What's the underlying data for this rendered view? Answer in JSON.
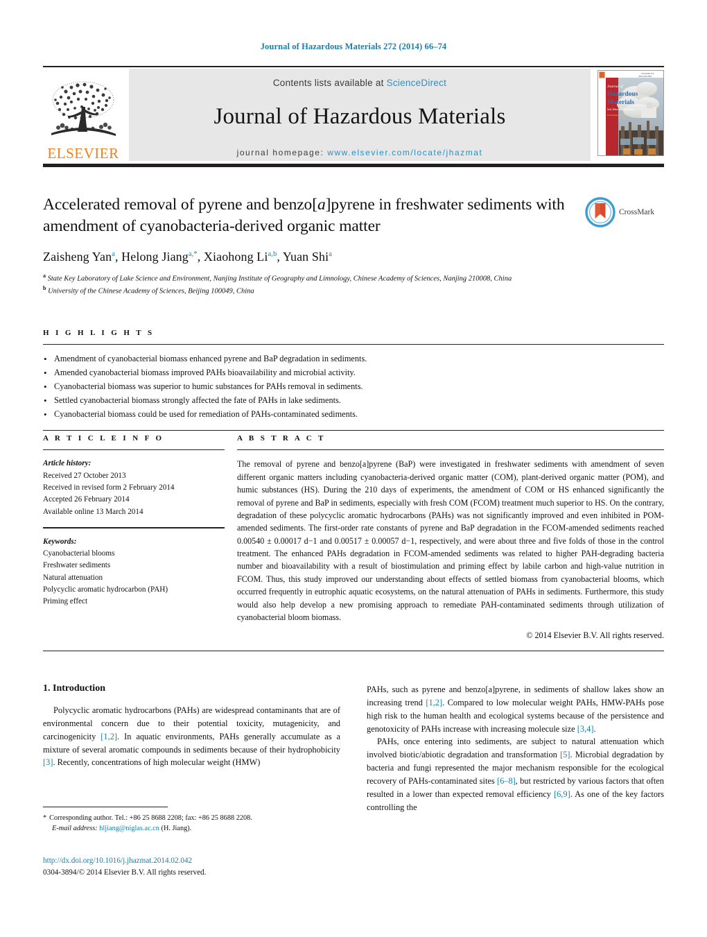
{
  "running_head": "Journal of Hazardous Materials 272 (2014) 66–74",
  "masthead": {
    "contents_prefix": "Contents lists available at ",
    "sciencedirect": "ScienceDirect",
    "journal_title": "Journal of Hazardous Materials",
    "homepage_prefix": "journal homepage: ",
    "homepage_url": "www.elsevier.com/locate/jhazmat",
    "publisher": "ELSEVIER",
    "publisher_logo_icon": "elsevier-tree-icon",
    "cover_icon": "journal-cover-thumbnail",
    "cover_title_line1": "Journal of",
    "cover_title_line2": "Hazardous",
    "cover_title_line3": "Materials"
  },
  "article": {
    "title": "Accelerated removal of pyrene and benzo[a]pyrene in freshwater sediments with amendment of cyanobacteria-derived organic matter",
    "title_part1": "Accelerated removal of pyrene and benzo[",
    "title_italic": "a",
    "title_part2": "]pyrene in freshwater sediments with amendment of cyanobacteria-derived organic matter",
    "crossmark_label": "CrossMark",
    "authors": [
      {
        "name": "Zaisheng Yan",
        "sup": "a"
      },
      {
        "name": "Helong Jiang",
        "sup": "a,*"
      },
      {
        "name": "Xiaohong Li",
        "sup": "a,b"
      },
      {
        "name": "Yuan Shi",
        "sup": "a"
      }
    ],
    "affiliations": [
      {
        "marker": "a",
        "text": "State Key Laboratory of Lake Science and Environment, Nanjing Institute of Geography and Limnology, Chinese Academy of Sciences, Nanjing 210008, China"
      },
      {
        "marker": "b",
        "text": "University of the Chinese Academy of Sciences, Beijing 100049, China"
      }
    ]
  },
  "highlights": {
    "label": "H I G H L I G H T S",
    "items": [
      "Amendment of cyanobacterial biomass enhanced pyrene and BaP degradation in sediments.",
      "Amended cyanobacterial biomass improved PAHs bioavailability and microbial activity.",
      "Cyanobacterial biomass was superior to humic substances for PAHs removal in sediments.",
      "Settled cyanobacterial biomass strongly affected the fate of PAHs in lake sediments.",
      "Cyanobacterial biomass could be used for remediation of PAHs-contaminated sediments."
    ]
  },
  "article_info": {
    "label": "A R T I C L E    I N F O",
    "history_heading": "Article history:",
    "history": [
      "Received 27 October 2013",
      "Received in revised form 2 February 2014",
      "Accepted 26 February 2014",
      "Available online 13 March 2014"
    ],
    "keywords_heading": "Keywords:",
    "keywords": [
      "Cyanobacterial blooms",
      "Freshwater sediments",
      "Natural attenuation",
      "Polycyclic aromatic hydrocarbon (PAH)",
      "Priming effect"
    ]
  },
  "abstract": {
    "label": "A B S T R A C T",
    "text": "The removal of pyrene and benzo[a]pyrene (BaP) were investigated in freshwater sediments with amendment of seven different organic matters including cyanobacteria-derived organic matter (COM), plant-derived organic matter (POM), and humic substances (HS). During the 210 days of experiments, the amendment of COM or HS enhanced significantly the removal of pyrene and BaP in sediments, especially with fresh COM (FCOM) treatment much superior to HS. On the contrary, degradation of these polycyclic aromatic hydrocarbons (PAHs) was not significantly improved and even inhibited in POM-amended sediments. The first-order rate constants of pyrene and BaP degradation in the FCOM-amended sediments reached 0.00540 ± 0.00017 d−1 and 0.00517 ± 0.00057 d−1, respectively, and were about three and five folds of those in the control treatment. The enhanced PAHs degradation in FCOM-amended sediments was related to higher PAH-degrading bacteria number and bioavailability with a result of biostimulation and priming effect by labile carbon and high-value nutrition in FCOM. Thus, this study improved our understanding about effects of settled biomass from cyanobacterial blooms, which occurred frequently in eutrophic aquatic ecosystems, on the natural attenuation of PAHs in sediments. Furthermore, this study would also help develop a new promising approach to remediate PAH-contaminated sediments through utilization of cyanobacterial bloom biomass.",
    "copyright": "© 2014 Elsevier B.V. All rights reserved."
  },
  "introduction": {
    "section_number": "1.",
    "section_title": "Introduction",
    "left_paragraph_1_a": "Polycyclic aromatic hydrocarbons (PAHs) are widespread contaminants that are of environmental concern due to their potential toxicity, mutagenicity, and carcinogenicity ",
    "left_ref_1": "[1,2]",
    "left_paragraph_1_b": ". In aquatic environments, PAHs generally accumulate as a mixture of several aromatic compounds in sediments because of their hydrophobicity ",
    "left_ref_2": "[3]",
    "left_paragraph_1_c": ". Recently, concentrations of high molecular weight (HMW)",
    "right_paragraph_1_a": "PAHs, such as pyrene and benzo[a]pyrene, in sediments of shallow lakes show an increasing trend ",
    "right_ref_1": "[1,2]",
    "right_paragraph_1_b": ". Compared to low molecular weight PAHs, HMW-PAHs pose high risk to the human health and ecological systems because of the persistence and genotoxicity of PAHs increase with increasing molecule size ",
    "right_ref_2": "[3,4]",
    "right_paragraph_1_c": ".",
    "right_paragraph_2_a": "PAHs, once entering into sediments, are subject to natural attenuation which involved biotic/abiotic degradation and transformation ",
    "right_ref_3": "[5]",
    "right_paragraph_2_b": ". Microbial degradation by bacteria and fungi represented the major mechanism responsible for the ecological recovery of PAHs-contaminated sites ",
    "right_ref_4": "[6–8]",
    "right_paragraph_2_c": ", but restricted by various factors that often resulted in a lower than expected removal efficiency ",
    "right_ref_5": "[6,9]",
    "right_paragraph_2_d": ". As one of the key factors controlling the"
  },
  "footnotes": {
    "corresponding_marker": "*",
    "corresponding_text": "Corresponding author. Tel.: +86 25 8688 2208; fax: +86 25 8688 2208.",
    "email_label": "E-mail address:",
    "email": "hljiang@niglas.ac.cn",
    "email_suffix": "(H. Jiang)."
  },
  "footer": {
    "doi": "http://dx.doi.org/10.1016/j.jhazmat.2014.02.042",
    "issn_copyright": "0304-3894/© 2014 Elsevier B.V. All rights reserved."
  },
  "colors": {
    "link_blue": "#1a7fa8",
    "sciencedirect_blue": "#2b8fc0",
    "elsevier_orange": "#f0801a",
    "rule_black": "#231f20",
    "band_gray": "#e7e7e7"
  }
}
